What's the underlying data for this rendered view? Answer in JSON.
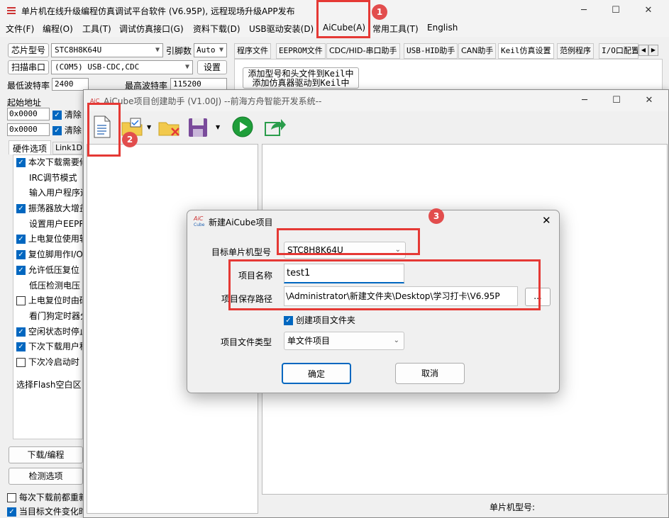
{
  "main_window": {
    "title": "单片机在线升级编程仿真调试平台软件 (V6.95P), 远程现场升级APP发布",
    "menus": [
      "文件(F)",
      "编程(O)",
      "工具(T)",
      "调试仿真接口(G)",
      "资料下载(D)",
      "USB驱动安装(D)",
      "AiCube(A)",
      "常用工具(T)",
      "English"
    ],
    "chip_label": "芯片型号",
    "chip_value": "STC8H8K64U",
    "pin_label": "引脚数",
    "pin_value": "Auto",
    "scan_button": "扫描串口",
    "port_value": "(COM5) USB-CDC,CDC",
    "settings_button": "设置",
    "min_baud_label": "最低波特率",
    "min_baud_value": "2400",
    "max_baud_label": "最高波特率",
    "max_baud_value": "115200",
    "start_addr_label": "起始地址",
    "addr1": "0x0000",
    "addr2": "0x0000",
    "clear_label": "清除",
    "hw_tabs": [
      "硬件选项",
      "Link1D"
    ],
    "options": [
      {
        "text": "本次下载需要修",
        "checked": true
      },
      {
        "text": "IRC调节模式",
        "checked": null
      },
      {
        "text": "输入用户程序运行",
        "checked": null
      },
      {
        "text": "振荡器放大增益",
        "checked": true
      },
      {
        "text": "设置用户EEPRO",
        "checked": null
      },
      {
        "text": "上电复位使用较",
        "checked": true
      },
      {
        "text": "复位脚用作I/O",
        "checked": true
      },
      {
        "text": "允许低压复位",
        "checked": true
      },
      {
        "text": "低压检测电压",
        "checked": null
      },
      {
        "text": "上电复位时由硬",
        "checked": false
      },
      {
        "text": "看门狗定时器分",
        "checked": null
      },
      {
        "text": "空闲状态时停止",
        "checked": true
      },
      {
        "text": "下次下载用户程",
        "checked": true
      },
      {
        "text": "下次冷启动时",
        "checked": false
      }
    ],
    "flash_label": "选择Flash空白区",
    "download_button": "下载/编程",
    "check_button": "检测选项",
    "bottom_opt1": "每次下载前都重新",
    "bottom_opt2": "当目标文件变化时",
    "right_tabs": [
      "程序文件",
      "EEPROM文件",
      "CDC/HID-串口助手",
      "USB-HID助手",
      "CAN助手",
      "Keil仿真设置",
      "范例程序",
      "I/O口配置"
    ],
    "keil_btn1": "添加型号和头文件到Keil中",
    "keil_btn2": "添加仿真器驱动到Keil中",
    "status_label": "单片机型号:"
  },
  "aicube_window": {
    "title": "AiCube项目创建助手 (V1.00J) --前海方舟智能开发系统--"
  },
  "dialog": {
    "title": "新建AiCube项目",
    "target_label": "目标单片机型号",
    "target_value": "STC8H8K64U",
    "name_label": "项目名称",
    "name_value": "test1",
    "path_label": "项目保存路径",
    "path_value": "\\Administrator\\新建文件夹\\Desktop\\学习打卡\\V6.95P",
    "browse_label": "...",
    "create_folder_label": "创建项目文件夹",
    "file_type_label": "项目文件类型",
    "file_type_value": "单文件项目",
    "ok_button": "确定",
    "cancel_button": "取消"
  },
  "annotations": [
    "1",
    "2",
    "3"
  ],
  "colors": {
    "accent": "#0067c0",
    "highlight": "#e53935",
    "badge": "#e24d4d"
  }
}
